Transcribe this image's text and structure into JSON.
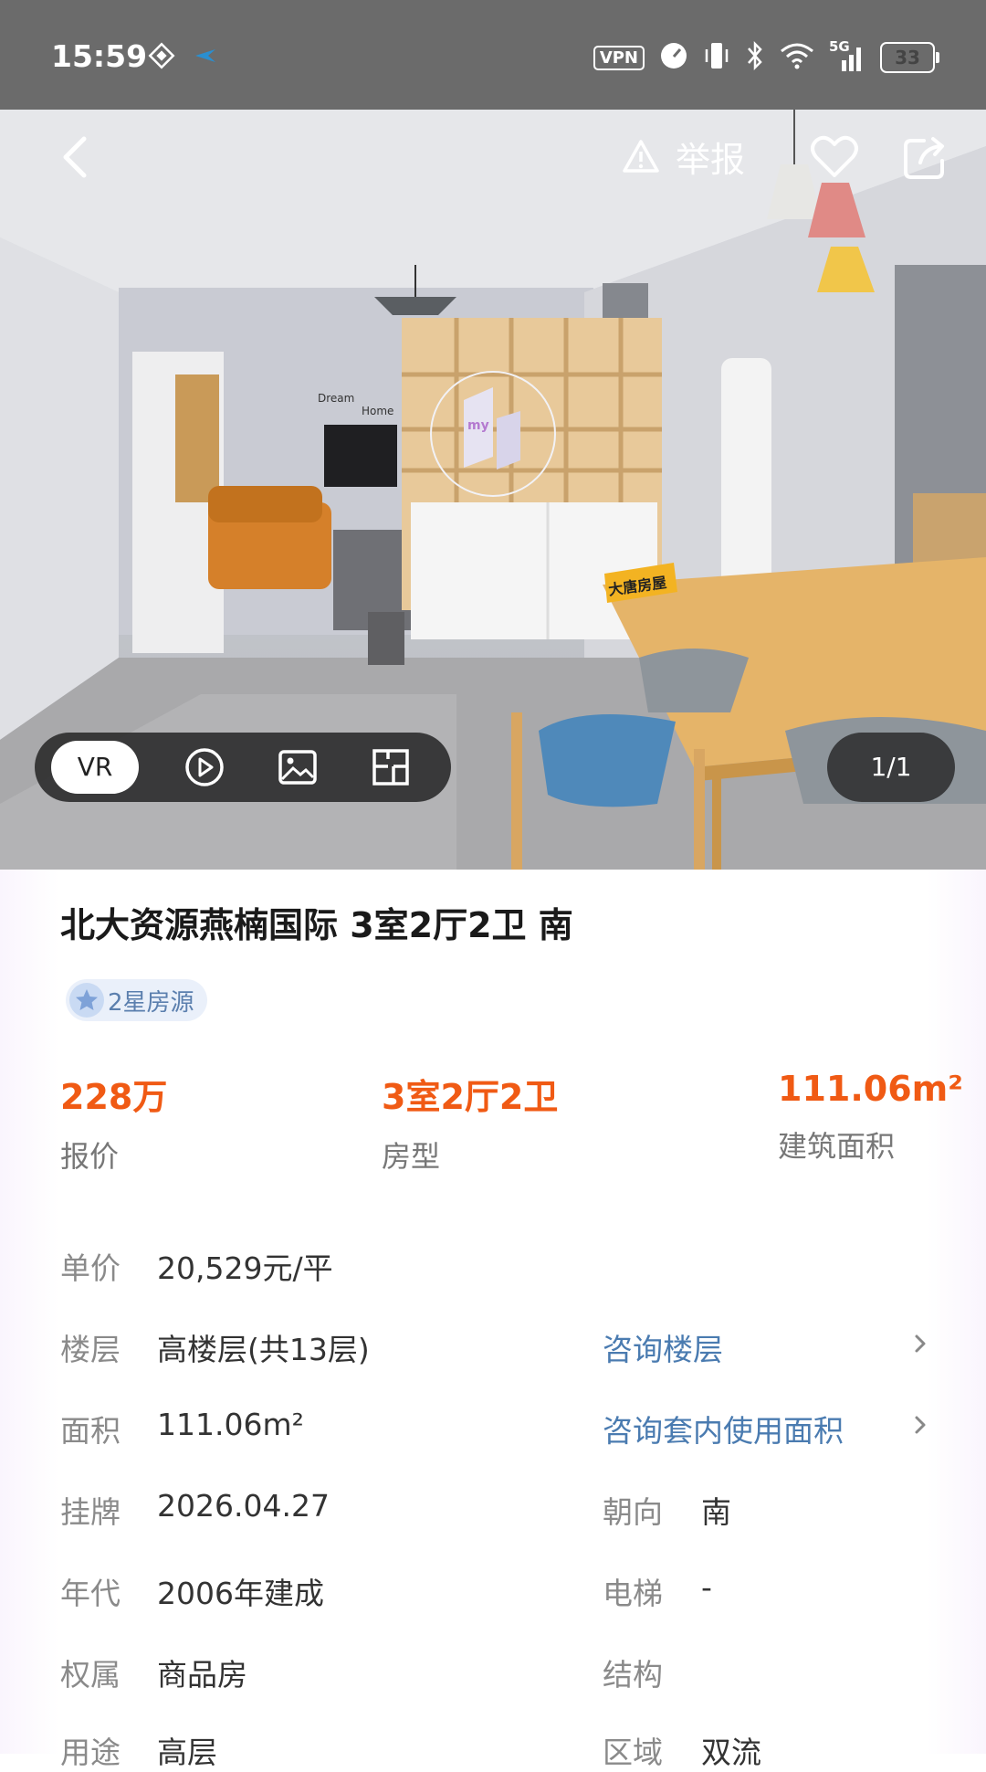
{
  "status_bar": {
    "time": "15:59",
    "vpn": "VPN",
    "network": "5G",
    "battery": "33",
    "battery_level": 0.33
  },
  "top_bar": {
    "report_label": "举报"
  },
  "media_bar": {
    "vr_label": "VR",
    "icons": [
      "play-icon",
      "image-icon",
      "floorplan-icon"
    ],
    "counter": "1/1"
  },
  "photo_signs": {
    "wall_text_1": "Dream",
    "wall_text_2": "Home",
    "agency_sign": "大唐房屋",
    "vr_logo": "my"
  },
  "listing": {
    "title": "北大资源燕楠国际 3室2厅2卫 南",
    "star_badge": "2星房源",
    "key_stats": [
      {
        "value": "228万",
        "label": "报价"
      },
      {
        "value": "3室2厅2卫",
        "label": "房型"
      },
      {
        "value": "111.06m²",
        "label": "建筑面积"
      }
    ],
    "details": {
      "unit_price": {
        "label": "单价",
        "value": "20,529元/平"
      },
      "floor": {
        "label": "楼层",
        "value": "高楼层(共13层)",
        "link": "咨询楼层"
      },
      "area": {
        "label": "面积",
        "value": "111.06m²",
        "link": "咨询套内使用面积"
      },
      "listed": {
        "label": "挂牌",
        "value": "2026.04.27"
      },
      "orientation": {
        "label": "朝向",
        "value": "南"
      },
      "year": {
        "label": "年代",
        "value": "2006年建成"
      },
      "elevator": {
        "label": "电梯",
        "value": "-"
      },
      "ownership": {
        "label": "权属",
        "value": "商品房"
      },
      "structure": {
        "label": "结构",
        "value": ""
      },
      "usage": {
        "label": "用途",
        "value": "高层"
      },
      "district": {
        "label": "区域",
        "value": "双流"
      }
    }
  },
  "colors": {
    "price_accent": "#f05a14",
    "link": "#4a7bb0",
    "label_gray": "#8a8a8a"
  }
}
